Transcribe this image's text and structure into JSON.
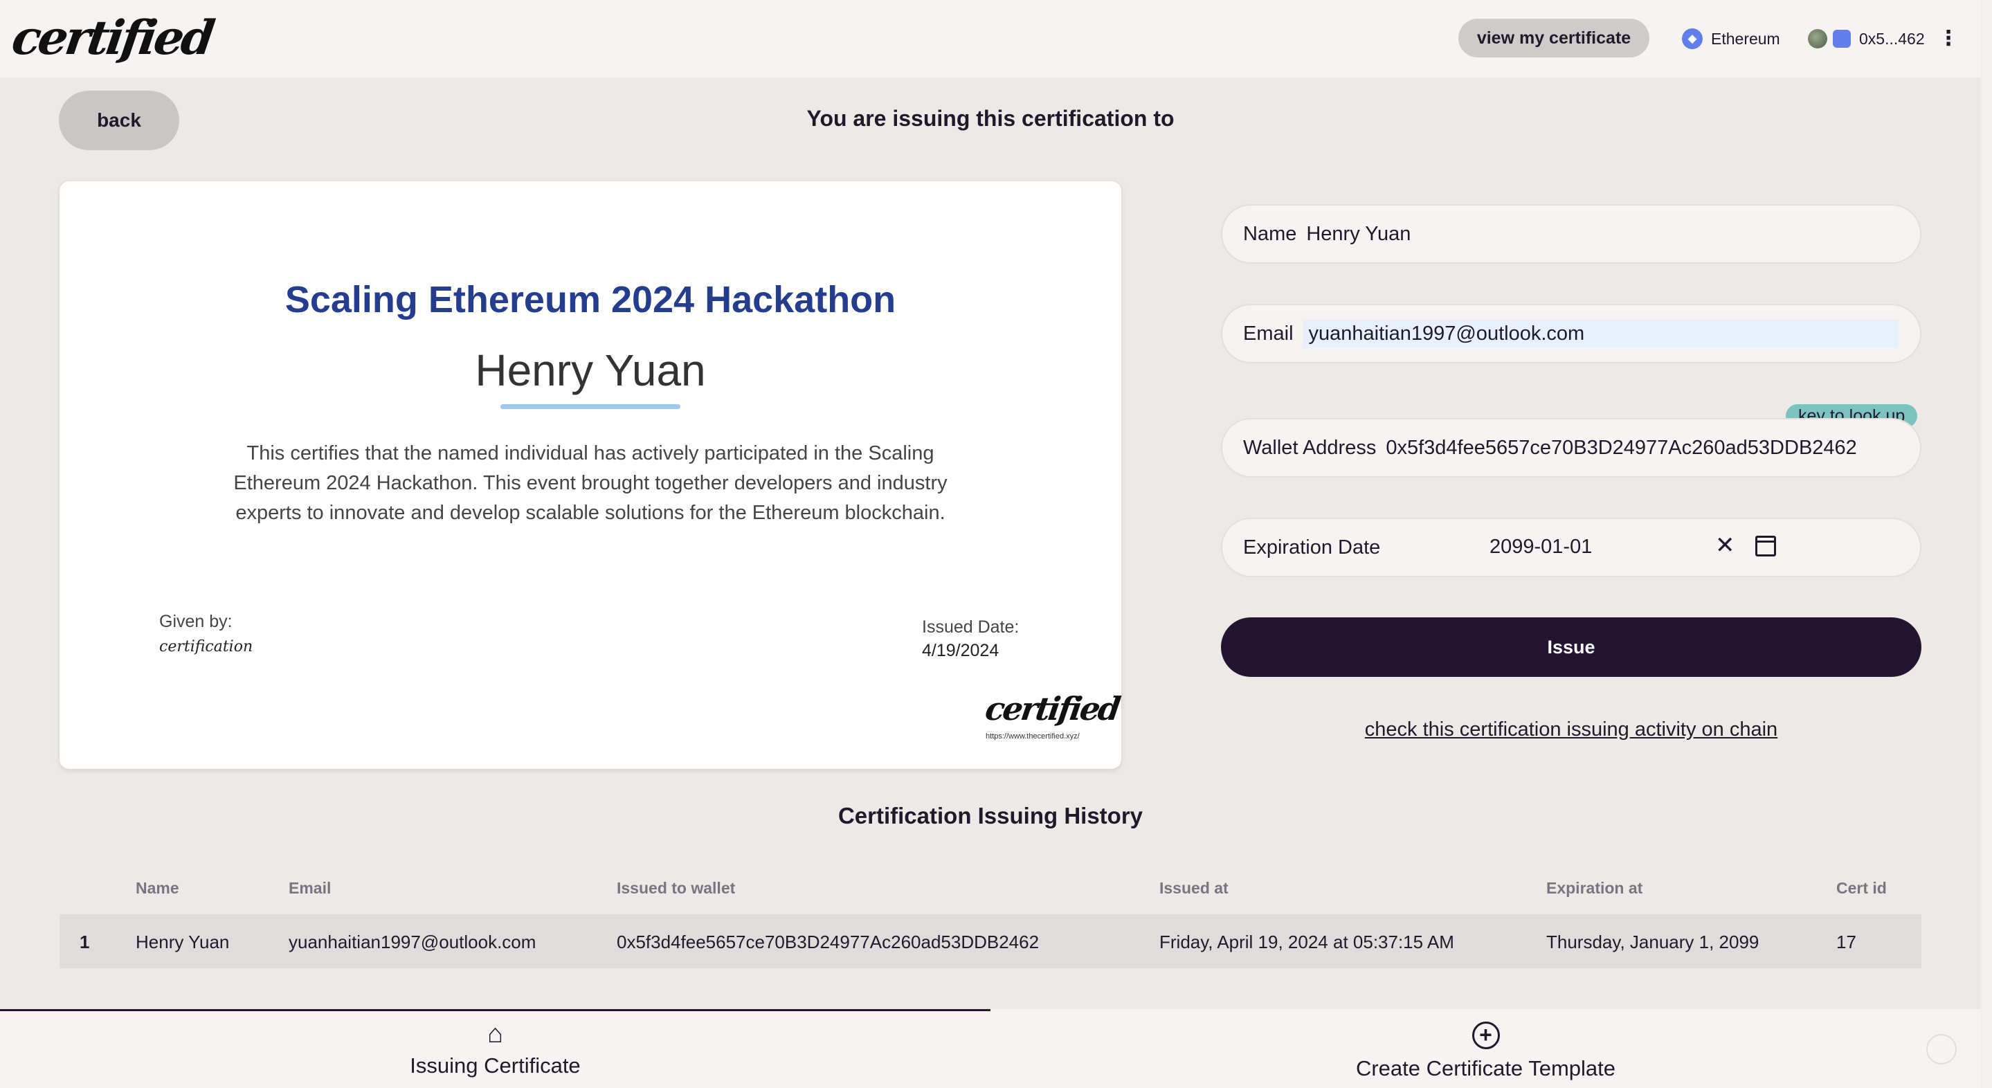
{
  "header": {
    "logo_text": "certified",
    "view_certificate_label": "view my certificate",
    "network": "Ethereum",
    "account": "0x5...462"
  },
  "top": {
    "back_label": "back",
    "title": "You are issuing this certification to"
  },
  "certificate": {
    "title": "Scaling Ethereum 2024 Hackathon",
    "recipient": "Henry Yuan",
    "description": "This certifies that the named individual has actively participated in the Scaling Ethereum 2024 Hackathon. This event brought together developers and industry experts to innovate and develop scalable solutions for the Ethereum blockchain.",
    "given_by_label": "Given by:",
    "given_by_signature": "certification",
    "issued_date_label": "Issued Date:",
    "issued_date": "4/19/2024",
    "logo_text": "certified",
    "url": "https://www.thecertified.xyz/"
  },
  "form": {
    "name_label": "Name",
    "name_value": "Henry Yuan",
    "email_label": "Email",
    "email_value": "yuanhaitian1997@outlook.com",
    "wallet_label": "Wallet Address",
    "wallet_value": "0x5f3d4fee5657ce70B3D24977Ac260ad53DDB2462",
    "lookup_badge": "key to look up",
    "expiration_label": "Expiration Date",
    "expiration_value": "2099-01-01",
    "issue_label": "Issue",
    "chain_link": "check this certification issuing activity on chain"
  },
  "history": {
    "title": "Certification Issuing History",
    "columns": [
      "Name",
      "Email",
      "Issued to wallet",
      "Issued at",
      "Expiration at",
      "Cert id"
    ],
    "rows": [
      {
        "index": "1",
        "name": "Henry Yuan",
        "email": "yuanhaitian1997@outlook.com",
        "wallet": "0x5f3d4fee5657ce70B3D24977Ac260ad53DDB2462",
        "issued_at": "Friday, April 19, 2024 at 05:37:15 AM",
        "expiration_at": "Thursday, January 1, 2099",
        "cert_id": "17"
      }
    ]
  },
  "bottom_nav": {
    "items": [
      {
        "label": "Issuing Certificate",
        "icon": "home-icon",
        "active": true
      },
      {
        "label": "Create Certificate Template",
        "icon": "plus-circle-icon",
        "active": false
      }
    ]
  },
  "colors": {
    "background": "#ede9e7",
    "primary_dark": "#23152f",
    "cert_title": "#243d8f",
    "underline_accent": "#9fc6ec",
    "lookup_badge": "#7cc3bf"
  }
}
